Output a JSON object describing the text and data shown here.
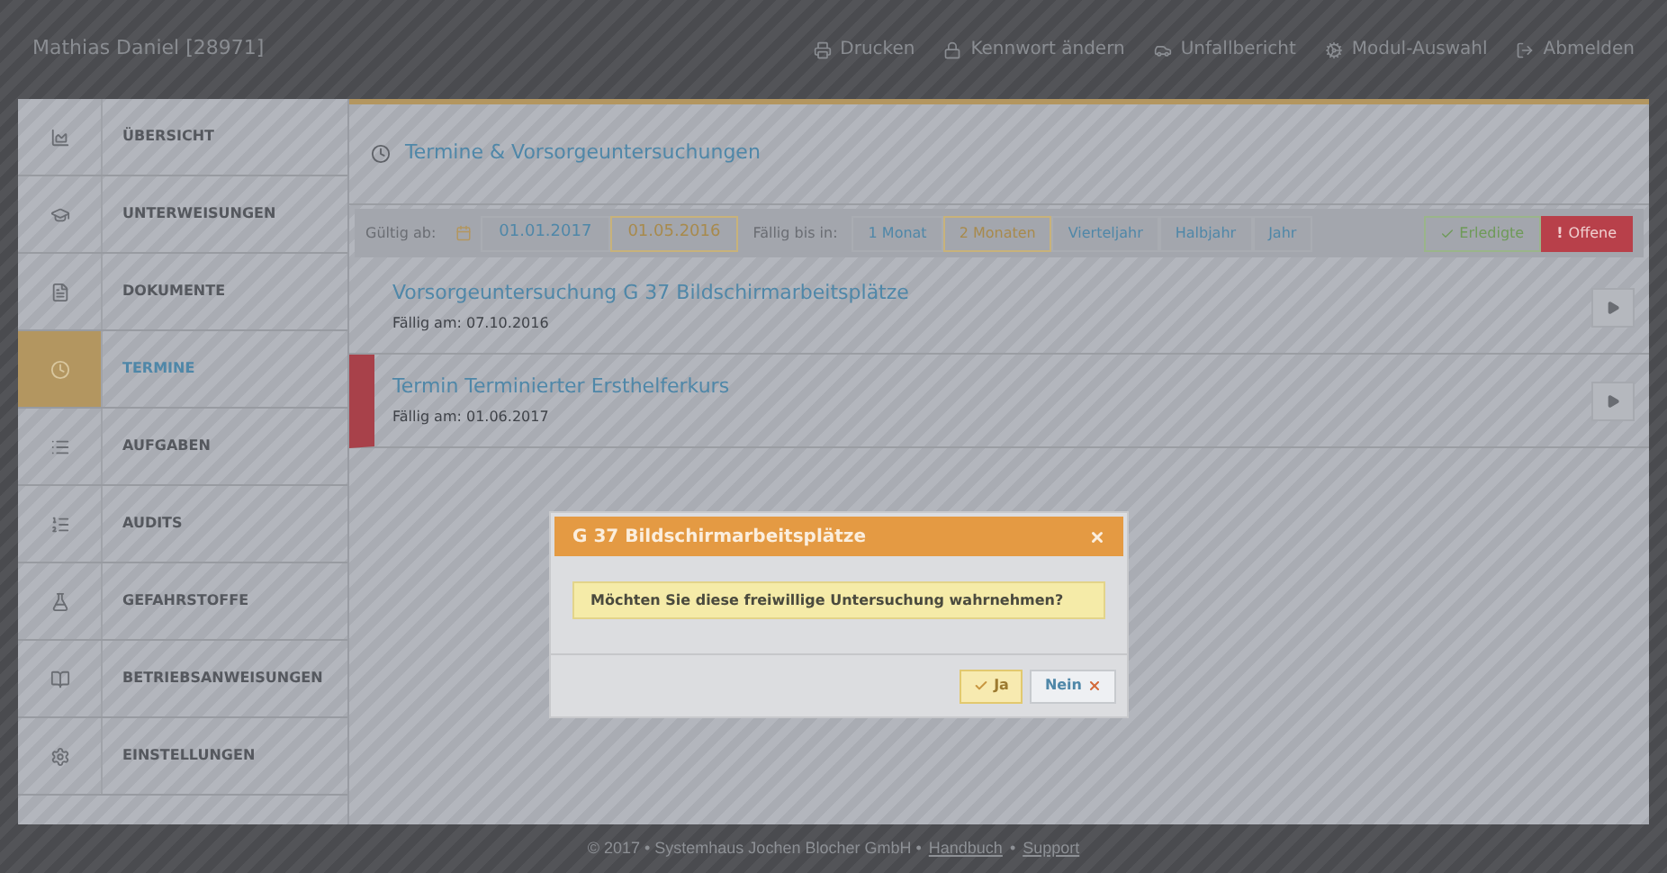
{
  "top_bar": {
    "user": "Mathias Daniel [28971]",
    "actions": [
      {
        "kind": "print",
        "label": "Drucken"
      },
      {
        "kind": "password",
        "label": "Kennwort ändern"
      },
      {
        "kind": "accident",
        "label": "Unfallbericht"
      },
      {
        "kind": "modules",
        "label": "Modul-Auswahl"
      },
      {
        "kind": "logout",
        "label": "Abmelden"
      }
    ]
  },
  "sidebar": {
    "items": [
      {
        "kind": "overview",
        "label": "ÜBERSICHT",
        "selected": false
      },
      {
        "kind": "training",
        "label": "UNTERWEISUNGEN",
        "selected": false
      },
      {
        "kind": "documents",
        "label": "DOKUMENTE",
        "selected": false
      },
      {
        "kind": "appointments",
        "label": "TERMINE",
        "selected": true
      },
      {
        "kind": "tasks",
        "label": "AUFGABEN",
        "selected": false
      },
      {
        "kind": "audits",
        "label": "AUDITS",
        "selected": false
      },
      {
        "kind": "hazards",
        "label": "GEFAHRSTOFFE",
        "selected": false
      },
      {
        "kind": "instructions",
        "label": "BETRIEBSANWEISUNGEN",
        "selected": false
      },
      {
        "kind": "settings",
        "label": "EINSTELLUNGEN",
        "selected": false
      }
    ]
  },
  "panel": {
    "title": "Termine & Vorsorgeuntersuchungen"
  },
  "filters": {
    "valid_from_label": "Gültig ab:",
    "valid_from": [
      {
        "label": "01.01.2017",
        "selected": false
      },
      {
        "label": "01.05.2016",
        "selected": true
      }
    ],
    "due_label": "Fällig bis in:",
    "due": [
      {
        "label": "1 Monat",
        "selected": false
      },
      {
        "label": "2 Monaten",
        "selected": true
      },
      {
        "label": "Vierteljahr",
        "selected": false
      },
      {
        "label": "Halbjahr",
        "selected": false
      },
      {
        "label": "Jahr",
        "selected": false
      }
    ],
    "status": [
      {
        "kind": "done",
        "label": "Erledigte",
        "selected": false
      },
      {
        "kind": "open",
        "label": "Offene",
        "mark": "!",
        "selected": true
      }
    ]
  },
  "rows": [
    {
      "title": "Vorsorgeuntersuchung G 37 Bildschirmarbeitsplätze",
      "due": "Fällig am: 07.10.2016",
      "overdue": false
    },
    {
      "title": "Termin Terminierter Ersthelferkurs",
      "due": "Fällig am: 01.06.2017",
      "overdue": true
    }
  ],
  "dialog": {
    "title": "G 37 Bildschirmarbeitsplätze",
    "message": "Möchten Sie diese freiwillige Untersuchung wahrnehmen?",
    "buttons": [
      {
        "kind": "confirm",
        "label": "Ja"
      },
      {
        "kind": "cancel",
        "label": "Nein"
      }
    ]
  },
  "footer": {
    "text": "© 2017 • Systemhaus Jochen Blocher GmbH •",
    "links": [
      {
        "label": "Handbuch"
      },
      {
        "label": "Support"
      }
    ],
    "separator": "•"
  }
}
